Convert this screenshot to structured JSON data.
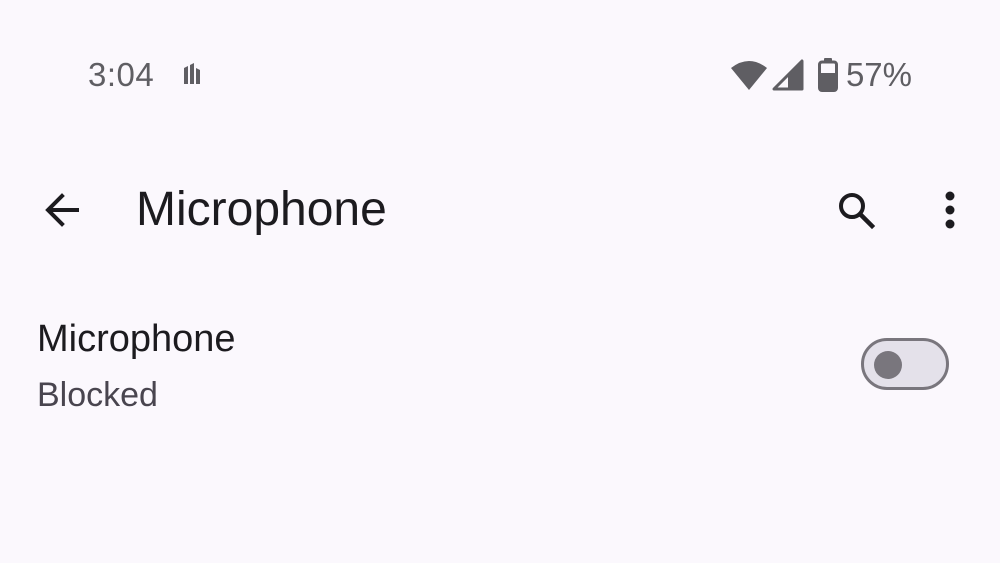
{
  "status_bar": {
    "time": "3:04",
    "battery_percent": "57%",
    "icons": {
      "notification": "notification-app-icon",
      "wifi": "wifi-icon",
      "signal": "cell-signal-icon",
      "battery": "battery-icon"
    }
  },
  "app_bar": {
    "title": "Microphone",
    "icons": {
      "back": "arrow-back-icon",
      "search": "search-icon",
      "more": "more-vert-icon"
    }
  },
  "setting": {
    "title": "Microphone",
    "summary": "Blocked",
    "toggle_on": false
  },
  "colors": {
    "background": "#fbf8fd",
    "text_primary": "#1c1b1f",
    "text_secondary": "#49454f",
    "toggle_outline": "#79767d",
    "toggle_track_off": "#e4e1ea"
  }
}
